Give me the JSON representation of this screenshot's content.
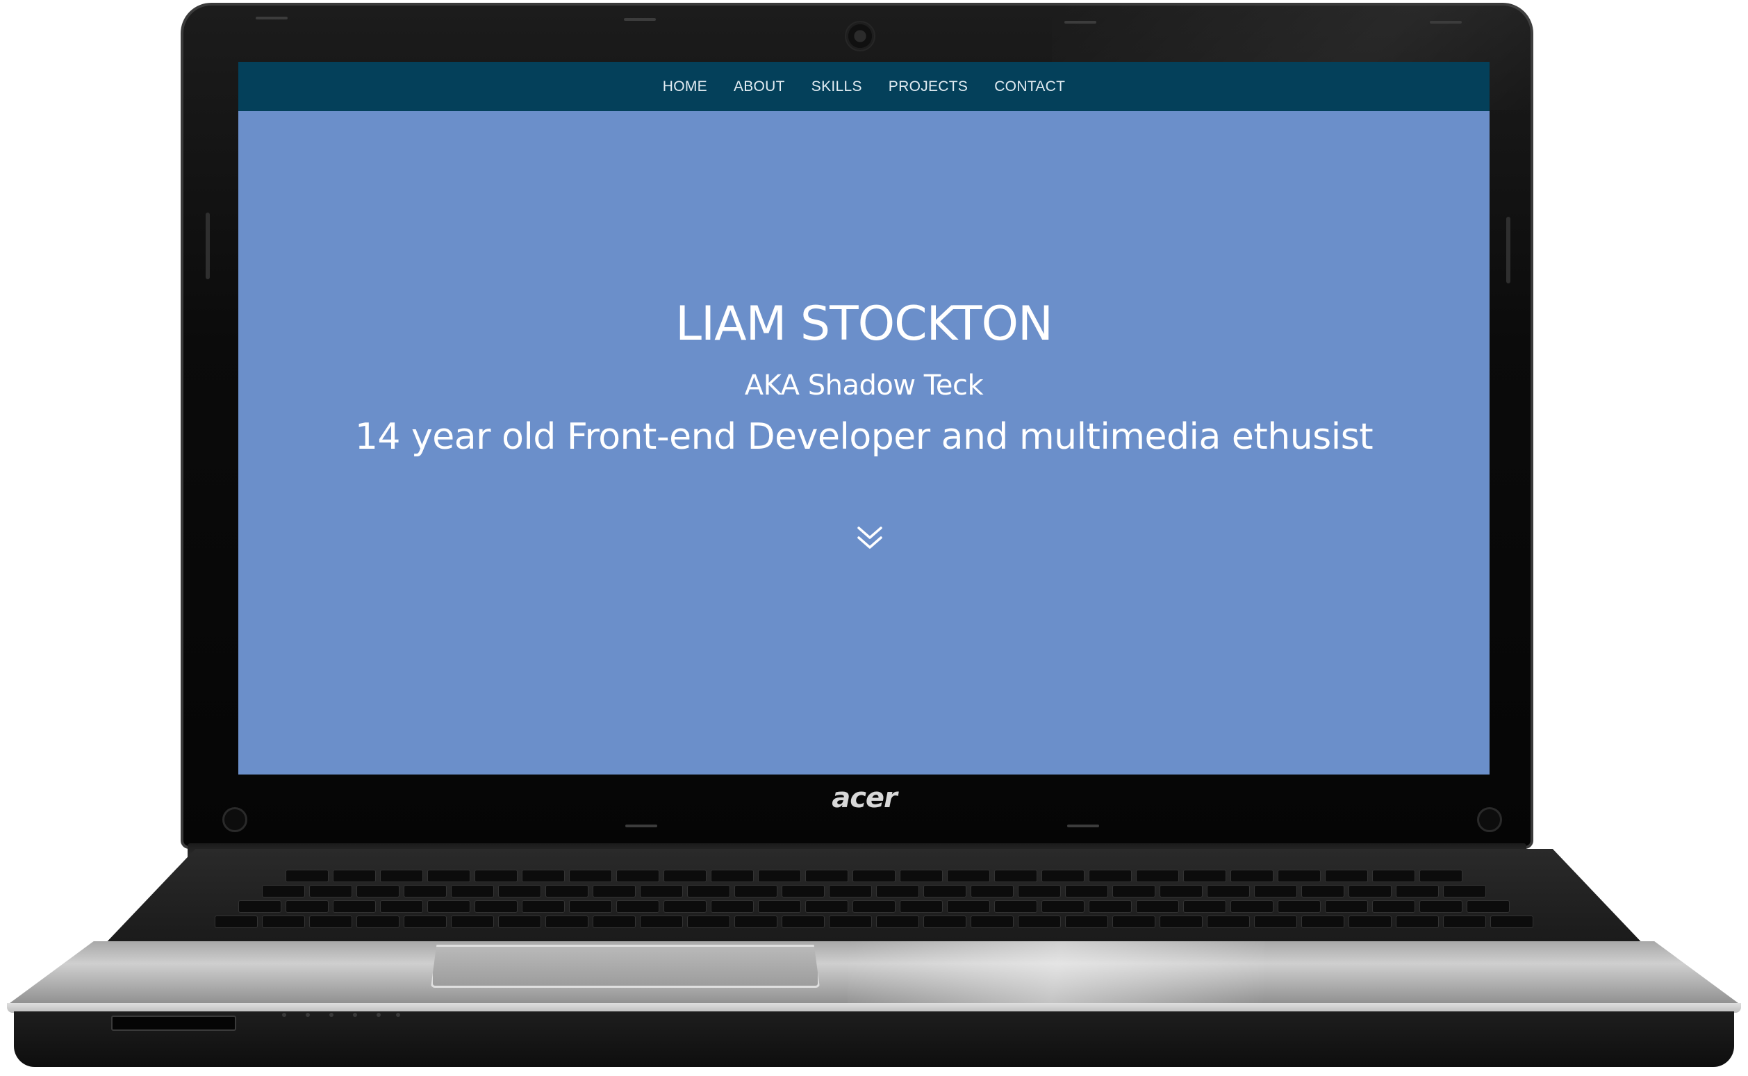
{
  "device": {
    "brand": "acer"
  },
  "site": {
    "nav": {
      "items": [
        {
          "label": "HOME"
        },
        {
          "label": "ABOUT"
        },
        {
          "label": "SKILLS"
        },
        {
          "label": "PROJECTS"
        },
        {
          "label": "CONTACT"
        }
      ]
    },
    "hero": {
      "name": "LIAM STOCKTON",
      "aka": "AKA Shadow Teck",
      "tagline": "14 year old Front-end Developer and multimedia ethusist",
      "scroll_icon": "double-chevron-down-icon"
    },
    "colors": {
      "nav_background": "#04405a",
      "hero_background": "#6b8fca",
      "text": "#ffffff"
    }
  }
}
